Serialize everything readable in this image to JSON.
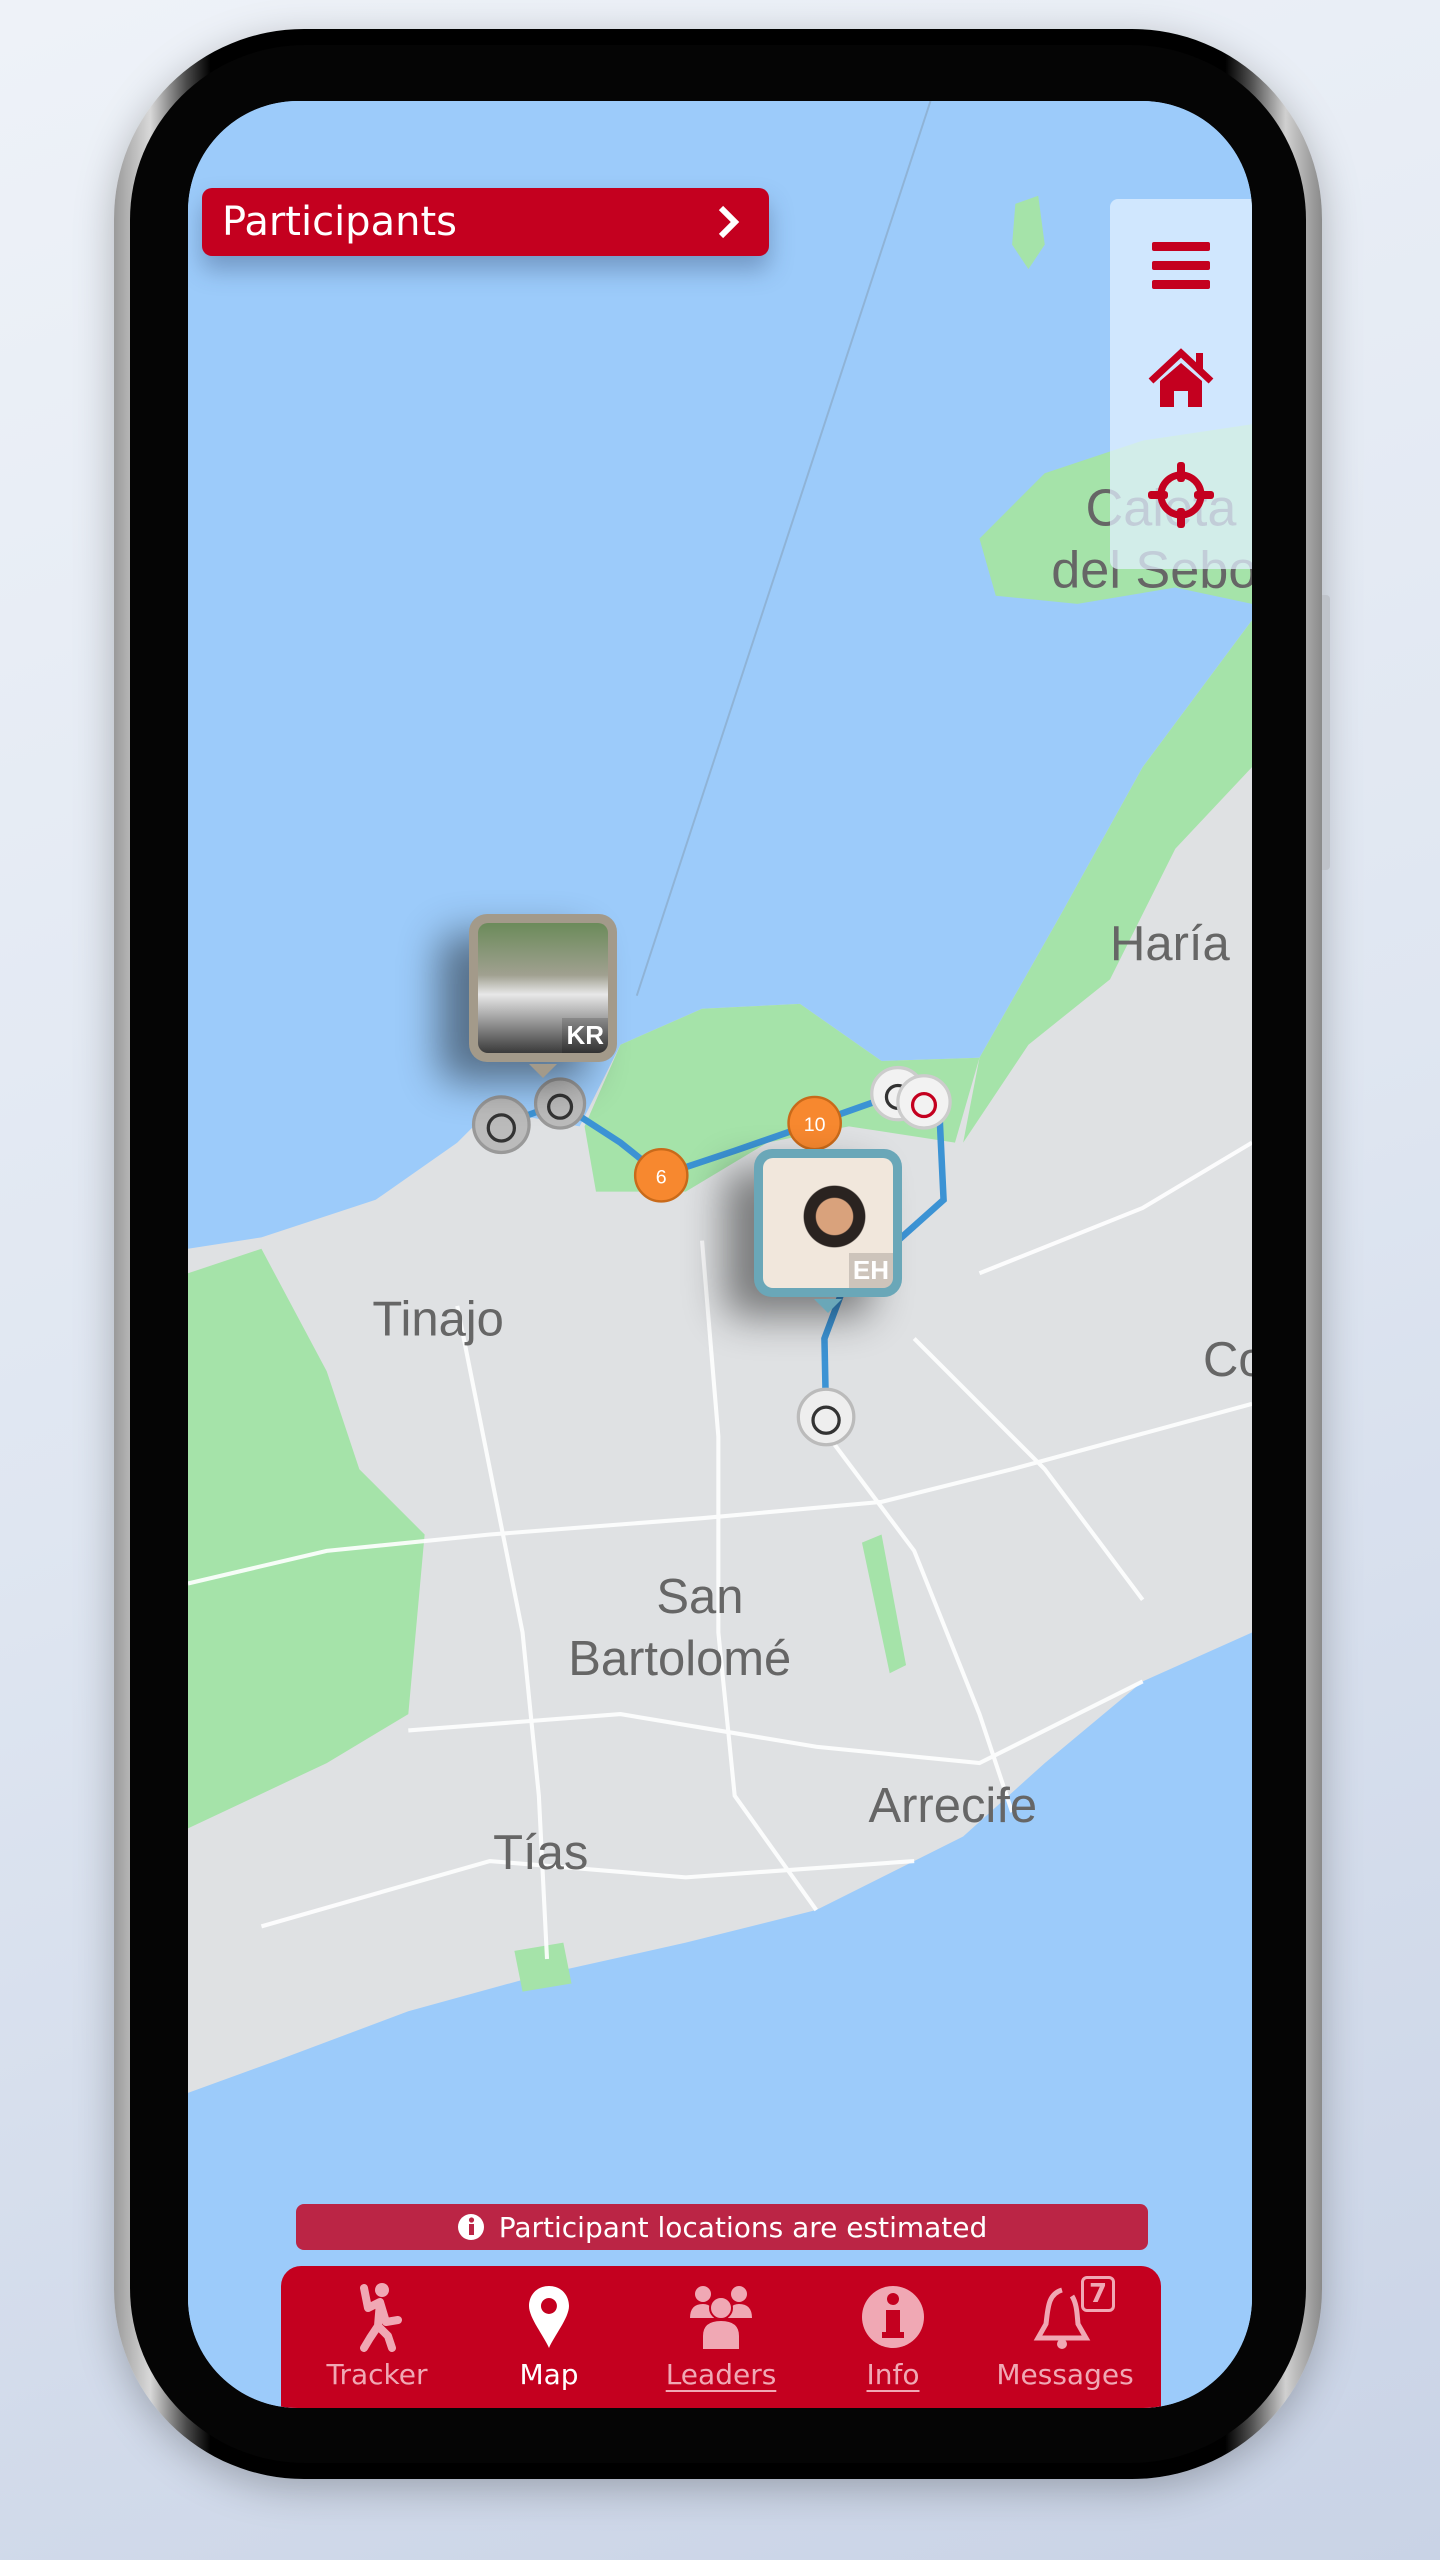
{
  "header": {
    "participants_label": "Participants",
    "chevron_icon": "chevron-right-icon"
  },
  "controls": [
    {
      "icon": "menu-icon"
    },
    {
      "icon": "home-icon"
    },
    {
      "icon": "crosshair-icon"
    }
  ],
  "map": {
    "labels": [
      "Caleta",
      "del Sebo",
      "Haría",
      "Tinajo",
      "San",
      "Bartolomé",
      "Tías",
      "Arrecife",
      "Co"
    ],
    "colors": {
      "water": "#9ccbfa",
      "land": "#dfe1e3",
      "park": "#a5e3a9",
      "route": "#3c93d4",
      "accent": "#c4001f"
    },
    "markers": [
      {
        "initials": "KR",
        "frame_color": "#a39a8a"
      },
      {
        "initials": "EH",
        "frame_color": "#6aa7b8"
      }
    ],
    "checkpoints": [
      "10",
      "6"
    ]
  },
  "notice": {
    "icon": "info-circle-icon",
    "text": "Participant locations are estimated"
  },
  "nav": [
    {
      "label": "Tracker",
      "icon": "runner-icon",
      "active": false
    },
    {
      "label": "Map",
      "icon": "map-pin-icon",
      "active": true
    },
    {
      "label": "Leaders",
      "icon": "users-icon",
      "active": false
    },
    {
      "label": "Info",
      "icon": "info-icon",
      "active": false
    },
    {
      "label": "Messages",
      "icon": "bell-icon",
      "active": false,
      "badge": "7"
    }
  ]
}
